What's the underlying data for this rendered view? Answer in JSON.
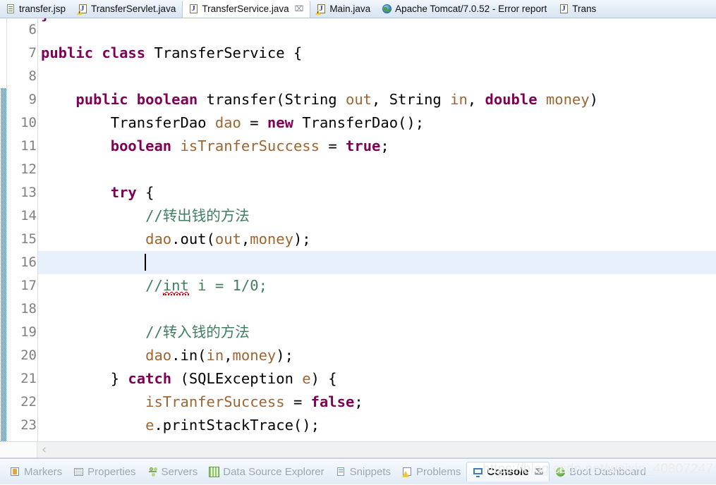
{
  "editor_tabs": [
    {
      "label": "transfer.jsp",
      "icon": "jsp-file-icon",
      "active": false,
      "closable": false
    },
    {
      "label": "TransferServlet.java",
      "icon": "java-warning-file-icon",
      "active": false,
      "closable": false
    },
    {
      "label": "TransferService.java",
      "icon": "java-file-icon",
      "active": true,
      "closable": true,
      "close_glyph": "⌧"
    },
    {
      "label": "Main.java",
      "icon": "java-warning-file-icon",
      "active": false,
      "closable": false
    },
    {
      "label": "Apache Tomcat/7.0.52 - Error report",
      "icon": "globe-icon",
      "active": false,
      "closable": false
    },
    {
      "label": "Trans",
      "icon": "java-file-icon",
      "active": false,
      "closable": false
    }
  ],
  "editor": {
    "file": "TransferService.java",
    "first_visible_line": 6,
    "current_line": 16,
    "lines": [
      {
        "num": 6,
        "tokens": []
      },
      {
        "num": 7,
        "tokens": [
          {
            "t": "public class ",
            "c": "kw"
          },
          {
            "t": "TransferService {",
            "c": "plain"
          }
        ]
      },
      {
        "num": 8,
        "tokens": []
      },
      {
        "num": 9,
        "tokens": [
          {
            "t": "    ",
            "c": "plain"
          },
          {
            "t": "public boolean ",
            "c": "kw"
          },
          {
            "t": "transfer(String ",
            "c": "plain"
          },
          {
            "t": "out",
            "c": "var"
          },
          {
            "t": ", String ",
            "c": "plain"
          },
          {
            "t": "in",
            "c": "var"
          },
          {
            "t": ", ",
            "c": "plain"
          },
          {
            "t": "double ",
            "c": "kw"
          },
          {
            "t": "money",
            "c": "var"
          },
          {
            "t": ")",
            "c": "plain"
          }
        ]
      },
      {
        "num": 10,
        "tokens": [
          {
            "t": "        TransferDao ",
            "c": "plain"
          },
          {
            "t": "dao ",
            "c": "var"
          },
          {
            "t": "= ",
            "c": "plain"
          },
          {
            "t": "new ",
            "c": "kw"
          },
          {
            "t": "TransferDao();",
            "c": "plain"
          }
        ]
      },
      {
        "num": 11,
        "tokens": [
          {
            "t": "        ",
            "c": "plain"
          },
          {
            "t": "boolean ",
            "c": "kw"
          },
          {
            "t": "isTranferSuccess ",
            "c": "var"
          },
          {
            "t": "= ",
            "c": "plain"
          },
          {
            "t": "true",
            "c": "kw"
          },
          {
            "t": ";",
            "c": "plain"
          }
        ]
      },
      {
        "num": 12,
        "tokens": []
      },
      {
        "num": 13,
        "tokens": [
          {
            "t": "        ",
            "c": "plain"
          },
          {
            "t": "try ",
            "c": "kw"
          },
          {
            "t": "{",
            "c": "plain"
          }
        ]
      },
      {
        "num": 14,
        "tokens": [
          {
            "t": "            ",
            "c": "plain"
          },
          {
            "t": "//转出钱的方法",
            "c": "cmt"
          }
        ]
      },
      {
        "num": 15,
        "tokens": [
          {
            "t": "            ",
            "c": "plain"
          },
          {
            "t": "dao",
            "c": "var"
          },
          {
            "t": ".out(",
            "c": "plain"
          },
          {
            "t": "out",
            "c": "var"
          },
          {
            "t": ",",
            "c": "plain"
          },
          {
            "t": "money",
            "c": "var"
          },
          {
            "t": ");",
            "c": "plain"
          }
        ]
      },
      {
        "num": 16,
        "tokens": [],
        "caret_col": 12,
        "current": true
      },
      {
        "num": 17,
        "tokens": [
          {
            "t": "            ",
            "c": "plain"
          },
          {
            "t": "//",
            "c": "cmt"
          },
          {
            "t": "int",
            "c": "cmt",
            "spell": true
          },
          {
            "t": " i = 1/0;",
            "c": "cmt"
          }
        ]
      },
      {
        "num": 18,
        "tokens": []
      },
      {
        "num": 19,
        "tokens": [
          {
            "t": "            ",
            "c": "plain"
          },
          {
            "t": "//转入钱的方法",
            "c": "cmt"
          }
        ]
      },
      {
        "num": 20,
        "tokens": [
          {
            "t": "            ",
            "c": "plain"
          },
          {
            "t": "dao",
            "c": "var"
          },
          {
            "t": ".in(",
            "c": "plain"
          },
          {
            "t": "in",
            "c": "var"
          },
          {
            "t": ",",
            "c": "plain"
          },
          {
            "t": "money",
            "c": "var"
          },
          {
            "t": ");",
            "c": "plain"
          }
        ]
      },
      {
        "num": 21,
        "tokens": [
          {
            "t": "        } ",
            "c": "plain"
          },
          {
            "t": "catch ",
            "c": "kw"
          },
          {
            "t": "(SQLException ",
            "c": "plain"
          },
          {
            "t": "e",
            "c": "var"
          },
          {
            "t": ") {",
            "c": "plain"
          }
        ]
      },
      {
        "num": 22,
        "tokens": [
          {
            "t": "            ",
            "c": "plain"
          },
          {
            "t": "isTranferSuccess ",
            "c": "var"
          },
          {
            "t": "= ",
            "c": "plain"
          },
          {
            "t": "false",
            "c": "kw"
          },
          {
            "t": ";",
            "c": "plain"
          }
        ]
      },
      {
        "num": 23,
        "tokens": [
          {
            "t": "            ",
            "c": "plain"
          },
          {
            "t": "e",
            "c": "var"
          },
          {
            "t": ".printStackTrace();",
            "c": "plain"
          }
        ]
      }
    ],
    "colors": {
      "keyword": "#7f0055",
      "comment": "#3f7f5f",
      "variable": "#9c6532",
      "plain": "#000000",
      "current_line_bg": "#e8f1fb",
      "change_marker": "#1a7fd4",
      "line_number": "#808080",
      "spell_error_underline": "#cc0000"
    }
  },
  "hscroll": {
    "left_chevron": "‹"
  },
  "view_tabs": [
    {
      "label": "Markers",
      "icon": "markers-icon",
      "active": false
    },
    {
      "label": "Properties",
      "icon": "properties-icon",
      "active": false
    },
    {
      "label": "Servers",
      "icon": "servers-icon",
      "active": false
    },
    {
      "label": "Data Source Explorer",
      "icon": "data-source-explorer-icon",
      "active": false
    },
    {
      "label": "Snippets",
      "icon": "snippets-icon",
      "active": false
    },
    {
      "label": "Problems",
      "icon": "problems-icon",
      "active": false
    },
    {
      "label": "Console",
      "icon": "console-icon",
      "active": true,
      "closable": true,
      "close_glyph": "⌧"
    },
    {
      "label": "Boot Dashboard",
      "icon": "boot-dashboard-icon",
      "active": false
    }
  ],
  "watermark": {
    "text": "https://blog.csdn.net/weixin_40807247"
  }
}
